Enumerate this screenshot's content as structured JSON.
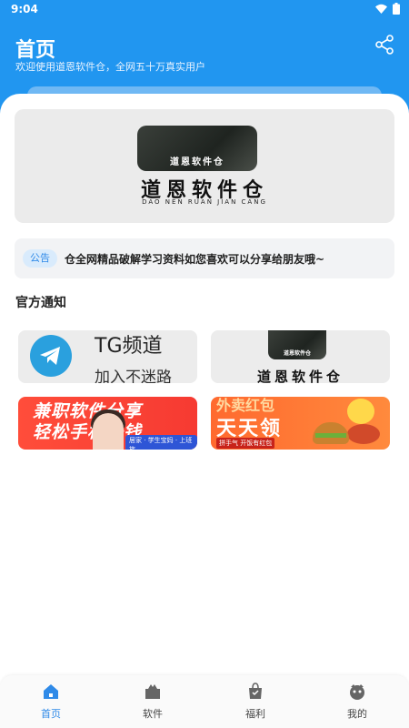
{
  "status_bar": {
    "time": "9:04"
  },
  "header": {
    "title": "首页",
    "subtitle": "欢迎使用道恩软件仓，全网五十万真实用户"
  },
  "banner": {
    "photo_caption": "道恩软件仓",
    "logo_text": "道恩软件仓",
    "pinyin": "DAO NEN RUAN JIAN CANG"
  },
  "notice": {
    "badge": "公告",
    "text": "仓全网精品破解学习资料如您喜欢可以分享给朋友哦~"
  },
  "section": {
    "title": "官方通知"
  },
  "cards": {
    "tg": {
      "title": "TG频道",
      "subtitle": "加入不迷路"
    },
    "logo": {
      "caption": "道恩软件仓",
      "text": "道恩软件仓"
    },
    "job": {
      "line1": "兼职软件分享",
      "line2": "轻松手机赚钱",
      "tags": "居家 · 学生宝妈 · 上班族"
    },
    "food": {
      "line1": "外卖红包",
      "line2": "天天领",
      "tag": "拼手气 开饭有红包"
    }
  },
  "nav": {
    "items": [
      {
        "label": "首页",
        "icon": "home-icon"
      },
      {
        "label": "软件",
        "icon": "box-icon"
      },
      {
        "label": "福利",
        "icon": "bag-icon"
      },
      {
        "label": "我的",
        "icon": "profile-icon"
      }
    ],
    "active_color": "#2f8ae8",
    "inactive_color": "#666666"
  },
  "colors": {
    "primary": "#2196f0",
    "notice_badge_bg": "#d9ebfc"
  }
}
